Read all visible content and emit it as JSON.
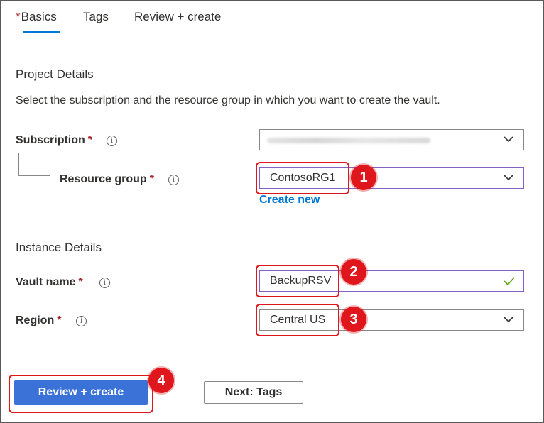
{
  "tabs": [
    {
      "label": "Basics",
      "required": "*",
      "selected": true
    },
    {
      "label": "Tags"
    },
    {
      "label": "Review + create"
    }
  ],
  "project": {
    "title": "Project Details",
    "description": "Select the subscription and the resource group in which you want to create the vault."
  },
  "fields": {
    "subscription": {
      "label": "Subscription",
      "required": "*"
    },
    "resource_group": {
      "label": "Resource group",
      "required": "*",
      "value": "ContosoRG1",
      "create_new": "Create new"
    },
    "vault_name": {
      "label": "Vault name",
      "required": "*",
      "value": "BackupRSV"
    },
    "region": {
      "label": "Region",
      "required": "*",
      "value": "Central US"
    }
  },
  "instance": {
    "title": "Instance Details"
  },
  "buttons": {
    "review_create": "Review + create",
    "next_tags": "Next: Tags"
  },
  "callouts": [
    "1",
    "2",
    "3",
    "4"
  ],
  "info_glyph": "i",
  "colors": {
    "accent": "#0078d4",
    "callout": "#e0161d",
    "primary_button": "#3a72d8",
    "active_border": "#8661c5",
    "valid_check": "#57a300"
  }
}
